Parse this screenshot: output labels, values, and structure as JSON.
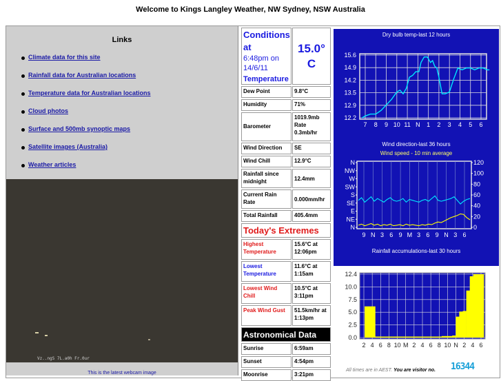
{
  "page": {
    "title": "Welcome to Kings Langley Weather, NW Sydney, NSW Australia"
  },
  "links": {
    "heading": "Links",
    "items": [
      "Climate data for this site",
      "Rainfall data for Australian locations",
      "Temperature data for Australian locations",
      "Cloud photos",
      "Surface and 500mb synoptic maps",
      "Satellite images (Australia)",
      "Weather articles"
    ]
  },
  "webcam": {
    "stamp": "Vz..ngS  7L.a0h  Fr.0ur",
    "caption": "This is the latest webcam image"
  },
  "conditions": {
    "label": "Conditions at",
    "time": "6:48pm on 14/6/11",
    "temp_label": "Temperature",
    "temp_value": "15.0° C",
    "rows": [
      {
        "label": "Dew Point",
        "value": "9.8°C"
      },
      {
        "label": "Humidity",
        "value": "71%"
      },
      {
        "label": "Barometer",
        "value": "1019.9mb Rate 0.3mb/hr"
      },
      {
        "label": "Wind Direction",
        "value": "SE"
      },
      {
        "label": "Wind Chill",
        "value": "12.9°C"
      },
      {
        "label": "Rainfall since midnight",
        "value": "12.4mm"
      },
      {
        "label": "Current Rain Rate",
        "value": "0.000mm/hr"
      },
      {
        "label": "Total Rainfall",
        "value": "405.4mm"
      }
    ]
  },
  "extremes": {
    "heading": "Today's Extremes",
    "rows": [
      {
        "label": "Highest Temperature",
        "value": "15.6°C at 12:06pm",
        "color": "red"
      },
      {
        "label": "Lowest Temperature",
        "value": "11.6°C at 1:15am",
        "color": "blue"
      },
      {
        "label": "Lowest Wind Chill",
        "value": "10.5°C at 3:11pm",
        "color": "red"
      },
      {
        "label": "Peak Wind Gust",
        "value": "51.5km/hr at 1:13pm",
        "color": "red"
      }
    ]
  },
  "astro": {
    "heading": "Astronomical Data",
    "rows": [
      {
        "label": "Sunrise",
        "value": "6:59am"
      },
      {
        "label": "Sunset",
        "value": "4:54pm"
      },
      {
        "label": "Moonrise",
        "value": "3:21pm"
      }
    ]
  },
  "colors": {
    "chart_bg": "#1212b4",
    "temp_line": "#00e8ff",
    "wind_dir": "#00e8ff",
    "wind_speed": "#ffff00",
    "rain_bar": "#ffff00"
  },
  "footer": {
    "note_prefix": "All times are in AEST.",
    "note_bold": "You are visitor no.",
    "counter": "16344"
  },
  "chart_data": [
    {
      "type": "line",
      "title": "Dry bulb temp-last 12 hours",
      "categories": [
        "7",
        "8",
        "9",
        "10",
        "11",
        "N",
        "1",
        "2",
        "3",
        "4",
        "5",
        "6"
      ],
      "y_ticks": [
        "15.6",
        "14.9",
        "14.2",
        "13.5",
        "12.9",
        "12.2"
      ],
      "ylim": [
        12.2,
        15.6
      ],
      "x": [
        6.7,
        7.0,
        7.5,
        8.0,
        8.5,
        9.0,
        9.5,
        10.0,
        10.3,
        10.6,
        10.9,
        11.2,
        11.5,
        11.8,
        12.1,
        12.3,
        12.6,
        12.9,
        13.2,
        13.4,
        13.6,
        13.8,
        14.0,
        14.3,
        14.6,
        15.0,
        15.4,
        15.8,
        16.2,
        16.6,
        17.0,
        17.4,
        17.8,
        18.2,
        18.6,
        18.8
      ],
      "y": [
        12.2,
        12.3,
        12.4,
        12.4,
        12.6,
        12.9,
        13.2,
        13.6,
        13.7,
        13.5,
        13.8,
        14.4,
        14.5,
        14.7,
        14.7,
        15.2,
        15.5,
        15.5,
        15.2,
        15.3,
        15.0,
        14.9,
        14.4,
        13.5,
        13.5,
        13.6,
        14.3,
        14.9,
        14.8,
        14.9,
        14.9,
        14.8,
        14.9,
        14.9,
        14.8,
        14.8
      ]
    },
    {
      "type": "line",
      "title": "Wind direction-last 36 hours",
      "subtitle": "Wind speed - 10 min average",
      "categories": [
        "9",
        "N",
        "3",
        "6",
        "9",
        "M",
        "3",
        "6",
        "9",
        "N",
        "3",
        "6"
      ],
      "y_ticks_left": [
        "N",
        "NW",
        "W",
        "SW",
        "S",
        "SE",
        "E",
        "NE",
        "N"
      ],
      "y_ticks_right": [
        "120",
        "100",
        "80",
        "60",
        "40",
        "20",
        "0"
      ],
      "series": [
        {
          "name": "Wind direction",
          "values": [
            150,
            165,
            140,
            155,
            170,
            145,
            160,
            150,
            140,
            155,
            165,
            150,
            145,
            150,
            160,
            140,
            155,
            150,
            145,
            140,
            150,
            155,
            145,
            160,
            175,
            150,
            145,
            150,
            155,
            160,
            170,
            150,
            130,
            145,
            155,
            160
          ]
        },
        {
          "name": "Wind speed",
          "values": [
            4,
            6,
            3,
            5,
            7,
            4,
            6,
            3,
            5,
            4,
            6,
            3,
            4,
            5,
            3,
            6,
            4,
            5,
            4,
            3,
            5,
            4,
            6,
            5,
            8,
            10,
            9,
            12,
            15,
            18,
            20,
            22,
            25,
            24,
            18,
            14
          ]
        }
      ]
    },
    {
      "type": "bar",
      "title": "Rainfall accumulations-last 30 hours",
      "categories": [
        "2",
        "4",
        "6",
        "8",
        "10",
        "M",
        "2",
        "4",
        "6",
        "8",
        "10",
        "N",
        "2",
        "4",
        "6"
      ],
      "y_ticks": [
        "12.4",
        "10.0",
        "7.5",
        "5.0",
        "2.5",
        "0.0"
      ],
      "ylim": [
        0,
        12.4
      ],
      "values": [
        0.0,
        6.1,
        6.1,
        6.1,
        0.2,
        0.2,
        0.2,
        0.2,
        0.2,
        0.2,
        0.2,
        0.2,
        0.2,
        0.2,
        0.2,
        0.2,
        0.2,
        0.2,
        0.2,
        0.2,
        0.2,
        0.2,
        0.2,
        0.3,
        0.3,
        0.3,
        0.4,
        4.1,
        5.1,
        5.2,
        9.2,
        12.0,
        12.4,
        12.4,
        12.4
      ]
    }
  ]
}
